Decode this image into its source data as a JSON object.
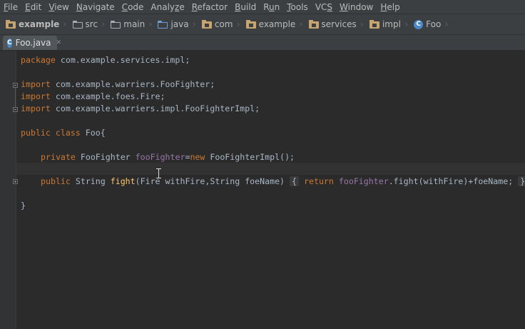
{
  "menu": [
    {
      "pre": "",
      "mn": "F",
      "post": "ile"
    },
    {
      "pre": "",
      "mn": "E",
      "post": "dit"
    },
    {
      "pre": "",
      "mn": "V",
      "post": "iew"
    },
    {
      "pre": "",
      "mn": "N",
      "post": "avigate"
    },
    {
      "pre": "",
      "mn": "C",
      "post": "ode"
    },
    {
      "pre": "Analy",
      "mn": "z",
      "post": "e"
    },
    {
      "pre": "",
      "mn": "R",
      "post": "efactor"
    },
    {
      "pre": "",
      "mn": "B",
      "post": "uild"
    },
    {
      "pre": "R",
      "mn": "u",
      "post": "n"
    },
    {
      "pre": "",
      "mn": "T",
      "post": "ools"
    },
    {
      "pre": "VC",
      "mn": "S",
      "post": ""
    },
    {
      "pre": "",
      "mn": "W",
      "post": "indow"
    },
    {
      "pre": "",
      "mn": "H",
      "post": "elp"
    }
  ],
  "breadcrumb": [
    {
      "label": "example",
      "icon": "project-icon"
    },
    {
      "label": "src",
      "icon": "folder-icon"
    },
    {
      "label": "main",
      "icon": "folder-icon"
    },
    {
      "label": "java",
      "icon": "source-folder-icon"
    },
    {
      "label": "com",
      "icon": "package-icon"
    },
    {
      "label": "example",
      "icon": "package-icon"
    },
    {
      "label": "services",
      "icon": "package-icon"
    },
    {
      "label": "impl",
      "icon": "package-icon"
    },
    {
      "label": "Foo",
      "icon": "class-icon"
    }
  ],
  "tab": {
    "label": "Foo.java",
    "icon_letter": "C"
  },
  "code": {
    "l1": {
      "k": "package",
      "t": " com.example.services.impl;"
    },
    "l3": {
      "k": "import",
      "t": " com.example.warriers.FooFighter;"
    },
    "l4": {
      "k": "import",
      "t": " com.example.foes.Fire;"
    },
    "l5": {
      "k": "import",
      "t": " com.example.warriers.impl.FooFighterImpl;"
    },
    "l7": {
      "k1": "public",
      "k2": "class",
      "t": " Foo{"
    },
    "l9": {
      "k1": "private",
      "t1": " FooFighter ",
      "f": "fooFighter",
      "t2": "=",
      "k2": "new",
      "t3": " FooFighterImpl();"
    },
    "l11": {
      "k1": "public",
      "t1": " String ",
      "fn": "fight",
      "t2": "(Fire withFire,String foeName)",
      "ob": "{",
      "k2": "return",
      "f": "fooFighter",
      "t3": ".fight(withFire)+foeName;",
      "cb": "}"
    },
    "l13": {
      "t": "}"
    }
  },
  "colors": {
    "keyword": "#cc7832",
    "field": "#9876aa",
    "method": "#ffc66d",
    "text": "#a9b7c6",
    "background": "#2b2b2b"
  }
}
